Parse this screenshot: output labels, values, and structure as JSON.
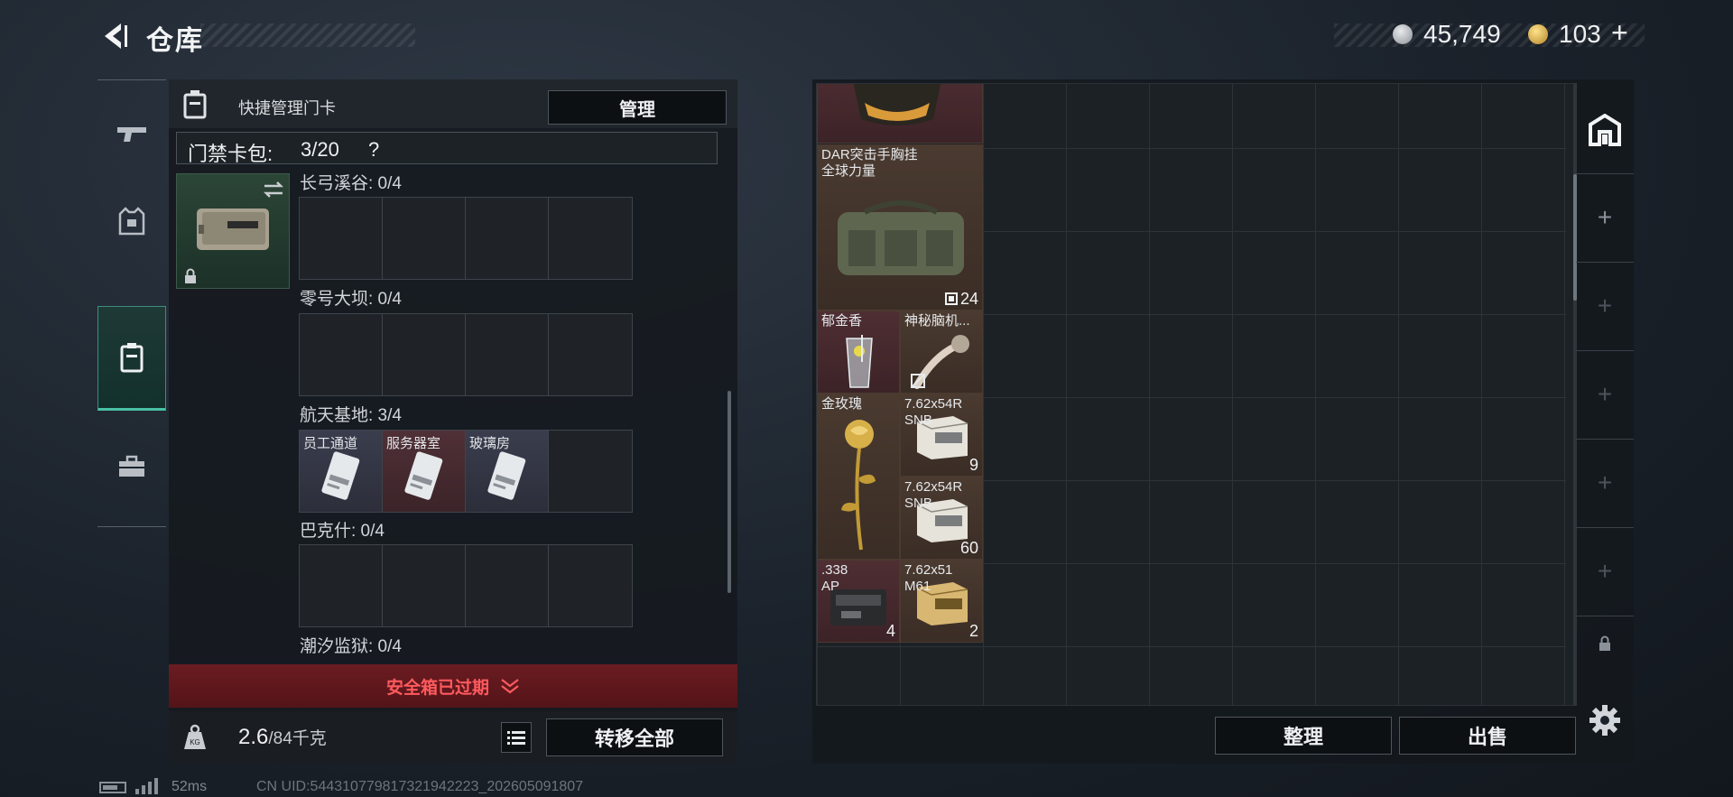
{
  "header": {
    "title": "仓库",
    "currency": [
      {
        "icon": "silver-coin-icon",
        "value": "45,749"
      },
      {
        "icon": "gold-coin-icon",
        "value": "103"
      }
    ],
    "add_label": "+"
  },
  "left_panel": {
    "header_label": "快捷管理门卡",
    "manage_label": "管理",
    "card_pack_label": "门禁卡包:",
    "card_pack_count": "3/20",
    "help_label": "?",
    "sections": [
      {
        "label": "长弓溪谷: 0/4",
        "cards": []
      },
      {
        "label": "零号大坝: 0/4",
        "cards": []
      },
      {
        "label": "航天基地: 3/4",
        "cards": [
          {
            "name": "员工通道",
            "rarity": "purple"
          },
          {
            "name": "服务器室",
            "rarity": "red"
          },
          {
            "name": "玻璃房",
            "rarity": "purple"
          }
        ]
      },
      {
        "label": "巴克什: 0/4",
        "cards": []
      },
      {
        "label": "潮汐监狱: 0/4",
        "cards": []
      }
    ],
    "expired_label": "安全箱已过期",
    "weight_value": "2.6",
    "weight_total": "/84千克",
    "transfer_label": "转移全部"
  },
  "stash": {
    "items": [
      {
        "name": "",
        "qty": "",
        "rarity": "red",
        "icon": "bag-icon"
      },
      {
        "name": "DAR突击手胸挂\n全球力量",
        "qty": "24",
        "rarity": "brown",
        "icon": "chest-rig-icon"
      },
      {
        "name": "郁金香",
        "qty": "",
        "rarity": "red",
        "icon": "cocktail-icon"
      },
      {
        "name": "神秘脑机...",
        "qty": "",
        "rarity": "brown",
        "icon": "brain-chip-icon"
      },
      {
        "name": "金玫瑰",
        "qty": "",
        "rarity": "brown",
        "icon": "golden-rose-icon"
      },
      {
        "name": "7.62x54R\nSNB",
        "qty": "9",
        "rarity": "brown",
        "icon": "ammo-box-icon"
      },
      {
        "name": "7.62x54R\nSNB",
        "qty": "60",
        "rarity": "brown",
        "icon": "ammo-box-icon"
      },
      {
        "name": ".338\nAP",
        "qty": "4",
        "rarity": "red",
        "icon": "ammo-box-dark-icon"
      },
      {
        "name": "7.62x51\nM61",
        "qty": "2",
        "rarity": "brown",
        "icon": "ammo-box-gold-icon"
      }
    ],
    "sort_label": "整理",
    "sell_label": "出售"
  },
  "right_strip": {
    "plus": "+"
  },
  "footer": {
    "ping": "52ms",
    "uid": "CN UID:544310779817321942223_202605091807"
  },
  "colors": {
    "accent": "#48c1a3",
    "danger": "#ff5a5e",
    "gold": "#d8b049"
  }
}
